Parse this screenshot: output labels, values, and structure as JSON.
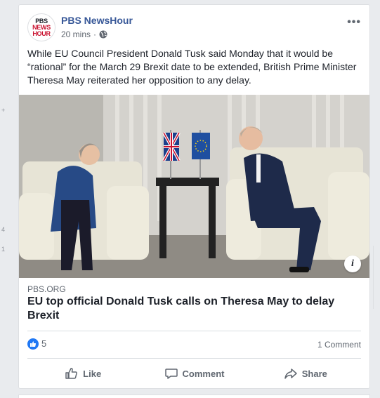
{
  "gutter": {
    "marks": [
      "+",
      "4",
      "1"
    ]
  },
  "post": {
    "page_name": "PBS NewsHour",
    "avatar_line1": "PBS",
    "avatar_line2": "NEWS",
    "avatar_line3": "HOUR",
    "time": "20 mins",
    "privacy_icon": "globe-icon",
    "more_label": "•••",
    "text": "While EU Council President Donald Tusk said Monday that it would be “rational” for the March 29 Brexit date to be extended, British Prime Minister Theresa May reiterated her opposition to any delay.",
    "info_label": "i",
    "link_domain": "PBS.ORG",
    "link_title": "EU top official Donald Tusk calls on Theresa May to delay Brexit",
    "like_count": "5",
    "comment_count": "1 Comment",
    "actions": {
      "like": "Like",
      "comment": "Comment",
      "share": "Share"
    }
  },
  "colors": {
    "brand_link": "#385898",
    "like_blue": "#2078f4",
    "muted": "#606770",
    "bg": "#e9ebee"
  }
}
